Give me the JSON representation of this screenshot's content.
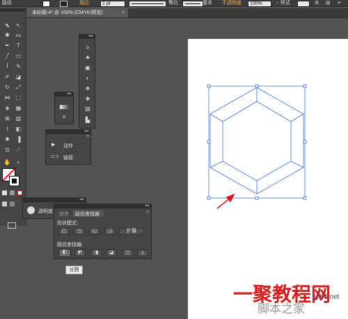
{
  "control_bar": {
    "selection_label": "路径",
    "stroke_label": "描边",
    "stroke_weight": "1 pt",
    "profile_label": "等比",
    "brush_label": "基本",
    "opacity_label": "不透明度",
    "opacity_value": "100%",
    "style_label": "样式"
  },
  "document_tab": {
    "title": "未标题-4* @ 100% (CMYK/预览)",
    "close": "×"
  },
  "panels": {
    "collapsed_panel_1": {
      "menu": "≡",
      "collapse": "◂◂"
    },
    "collapsed_panel_2": {
      "menu": "≡",
      "collapse": "◂◂"
    },
    "actions_panel": {
      "actions_label": "动作",
      "links_label": "链接",
      "collapse": "◂◂",
      "menu": "≡"
    },
    "transparency_panel": {
      "tab_label": "透明度",
      "collapse": "◂◂"
    },
    "pathfinder_panel": {
      "tabs": [
        "对齐",
        "路径查找器"
      ],
      "active_tab": "路径查找器",
      "shape_modes_label": "形状模式:",
      "expand_button": "扩展",
      "pathfinders_label": "路径查找器:",
      "collapse": "◂◂",
      "menu": "≡"
    }
  },
  "tooltip": {
    "text": "分割"
  },
  "annotations": {
    "arrow_color": "#e0141e"
  },
  "selection_color": "#3b6fd6",
  "watermark": {
    "line1": "一聚教程网",
    "url": "jb51.net",
    "line2": "脚本之家"
  }
}
